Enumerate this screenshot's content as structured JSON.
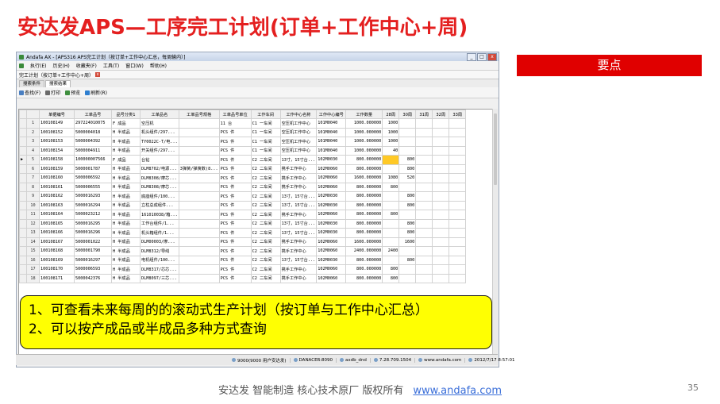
{
  "slide": {
    "title": "安达发APS—工序完工计划(订单+工作中心+周)",
    "keypoints_label": "要点",
    "callout_lines": [
      "1、可查看未来每周的的滚动式生产计划（按订单与工作中心汇总）",
      "2、可以按产成品或半成品多种方式查询"
    ],
    "footer_text": "安达发   智能制造 核心技术原厂   版权所有",
    "footer_link": "www.andafa.com",
    "page_number": "35"
  },
  "app": {
    "window_title": "Andafa AX - [APS316 APS完工计划（按订单+工作中心汇总，每周输内）]",
    "window_buttons": [
      "_",
      "□",
      "x"
    ],
    "menu": [
      "执行(E)",
      "历史(H)",
      "收藏夹(F)",
      "工具(T)",
      "窗口(W)",
      "帮助(H)"
    ],
    "doc_tab": "完工计划（按订单+工作中心+周）",
    "doc_tab_close": "x",
    "subtabs": [
      "搜索条件",
      "搜索结果"
    ],
    "toolbar": [
      {
        "icon": "search-icon",
        "label": "查找(F)",
        "color": "#4a7fc1"
      },
      {
        "icon": "print-icon",
        "label": "打印",
        "color": "#6a6a6a"
      },
      {
        "icon": "preview-icon",
        "label": "预览",
        "color": "#3f8f3f"
      },
      {
        "icon": "refresh-icon",
        "label": "刷新(R)",
        "color": "#2f7fd0"
      }
    ],
    "columns": [
      "",
      "",
      "单据编号",
      "工单品号",
      "品号分类1",
      "工单品名",
      "工单品号规格",
      "工单品号单位",
      "工作车间",
      "工作中心名称",
      "工作中心编号",
      "工作数量",
      "28周",
      "30周",
      "31周",
      "32周",
      "33周"
    ],
    "rows": [
      [
        "",
        "1",
        "100108149",
        "297224010075",
        "F 成品",
        "空压机",
        "",
        "11 台",
        "C1 一车间",
        "空压机工作中心",
        "101M0040",
        "1000.000000",
        "1000",
        "",
        "",
        "",
        ""
      ],
      [
        "",
        "2",
        "100108152",
        "5000004018",
        "H 半成品",
        "机头组件/297...",
        "",
        "PCS 件",
        "C1 一车间",
        "空压机工作中心",
        "101M0040",
        "1000.000000",
        "1000",
        "",
        "",
        "",
        ""
      ],
      [
        "",
        "3",
        "100108153",
        "5000004392",
        "H 半成品",
        "TY0022C-T/电...",
        "",
        "PCS 件",
        "C1 一车间",
        "空压机工作中心",
        "101M0040",
        "1000.000000",
        "1000",
        "",
        "",
        "",
        ""
      ],
      [
        "",
        "4",
        "100108154",
        "5000004911",
        "H 半成品",
        "开关组件/297...",
        "",
        "PCS 件",
        "C1 一车间",
        "空压机工作中心",
        "101M0040",
        "1000.000000",
        "40",
        "",
        "",
        "",
        ""
      ],
      [
        "▶",
        "5",
        "100108158",
        "100000007566",
        "F 成品",
        "台钻",
        "",
        "PCS 件",
        "C2 二车间",
        "13寸，15寸台...",
        "102M0030",
        "800.000000",
        "",
        "800",
        "",
        "",
        ""
      ],
      [
        "",
        "6",
        "100108159",
        "5000001787",
        "H 半成品",
        "DLM8702/电源...",
        "3弹簧/弹簧数(8...",
        "PCS 件",
        "C2 二车间",
        "携手工作中心",
        "102M0060",
        "800.000000",
        "",
        "800",
        "",
        "",
        ""
      ],
      [
        "",
        "7",
        "100108160",
        "5000006592",
        "H 半成品",
        "DLM8308/摩芯...",
        "",
        "PCS 件",
        "C2 二车间",
        "携手工作中心",
        "102M0060",
        "1600.000000",
        "1080",
        "520",
        "",
        "",
        ""
      ],
      [
        "",
        "8",
        "100108161",
        "5000006555",
        "H 半成品",
        "DLM8308/摩芯...",
        "",
        "PCS 件",
        "C2 二车间",
        "携手工作中心",
        "102M0060",
        "800.000000",
        "800",
        "",
        "",
        "",
        ""
      ],
      [
        "",
        "9",
        "100108162",
        "5000016293",
        "H 半成品",
        "底座组件/100...",
        "",
        "PCS 件",
        "C2 二车间",
        "13寸，15寸台...",
        "102M0030",
        "800.000000",
        "",
        "800",
        "",
        "",
        ""
      ],
      [
        "",
        "10",
        "100108163",
        "5000016294",
        "H 半成品",
        "立柱总成组件...",
        "",
        "PCS 件",
        "C2 二车间",
        "13寸，15寸台...",
        "102M0030",
        "800.000000",
        "",
        "800",
        "",
        "",
        ""
      ],
      [
        "",
        "11",
        "100108164",
        "5000023212",
        "H 半成品",
        "161010038/箱...",
        "",
        "PCS 件",
        "C2 二车间",
        "携手工作中心",
        "102M0060",
        "800.000000",
        "800",
        "",
        "",
        "",
        ""
      ],
      [
        "",
        "12",
        "100108165",
        "5000016295",
        "H 半成品",
        "工作台组件/1...",
        "",
        "PCS 件",
        "C2 二车间",
        "13寸，15寸台...",
        "102M0030",
        "800.000000",
        "",
        "800",
        "",
        "",
        ""
      ],
      [
        "",
        "13",
        "100108166",
        "5000016296",
        "H 半成品",
        "机头箱组件/1...",
        "",
        "PCS 件",
        "C2 二车间",
        "13寸，15寸台...",
        "102M0030",
        "800.000000",
        "",
        "800",
        "",
        "",
        ""
      ],
      [
        "",
        "14",
        "100108167",
        "5000001022",
        "H 半成品",
        "DLM00003/摩...",
        "",
        "PCS 件",
        "C2 二车间",
        "携手工作中心",
        "102M0060",
        "1600.000000",
        "",
        "1600",
        "",
        "",
        ""
      ],
      [
        "",
        "15",
        "100108168",
        "5000001790",
        "H 半成品",
        "DLM8312/导线",
        "",
        "PCS 件",
        "C2 二车间",
        "携手工作中心",
        "102M0060",
        "2400.000000",
        "2400",
        "",
        "",
        "",
        ""
      ],
      [
        "",
        "16",
        "100108169",
        "5000016297",
        "H 半成品",
        "电机组件/100...",
        "",
        "PCS 件",
        "C2 二车间",
        "13寸，15寸台...",
        "102M0030",
        "800.000000",
        "",
        "800",
        "",
        "",
        ""
      ],
      [
        "",
        "17",
        "100108170",
        "5000006593",
        "H 半成品",
        "DLM8317/芯芯...",
        "",
        "PCS 件",
        "C2 二车间",
        "携手工作中心",
        "102M0060",
        "800.000000",
        "800",
        "",
        "",
        "",
        ""
      ],
      [
        "",
        "18",
        "100108171",
        "5000042376",
        "H 半成品",
        "DLM8097/三芯...",
        "",
        "PCS 件",
        "C2 二车间",
        "携手工作中心",
        "102M0060",
        "800.000000",
        "800",
        "",
        "",
        "",
        ""
      ]
    ],
    "status": [
      "9000(9000 用户安达发)",
      "DANACER:8090",
      "axdb_dnd",
      "7.28.709.1504",
      "www.andafa.com",
      "2012/7/17 8:57:01"
    ],
    "highlight_color": "#ffc926"
  }
}
